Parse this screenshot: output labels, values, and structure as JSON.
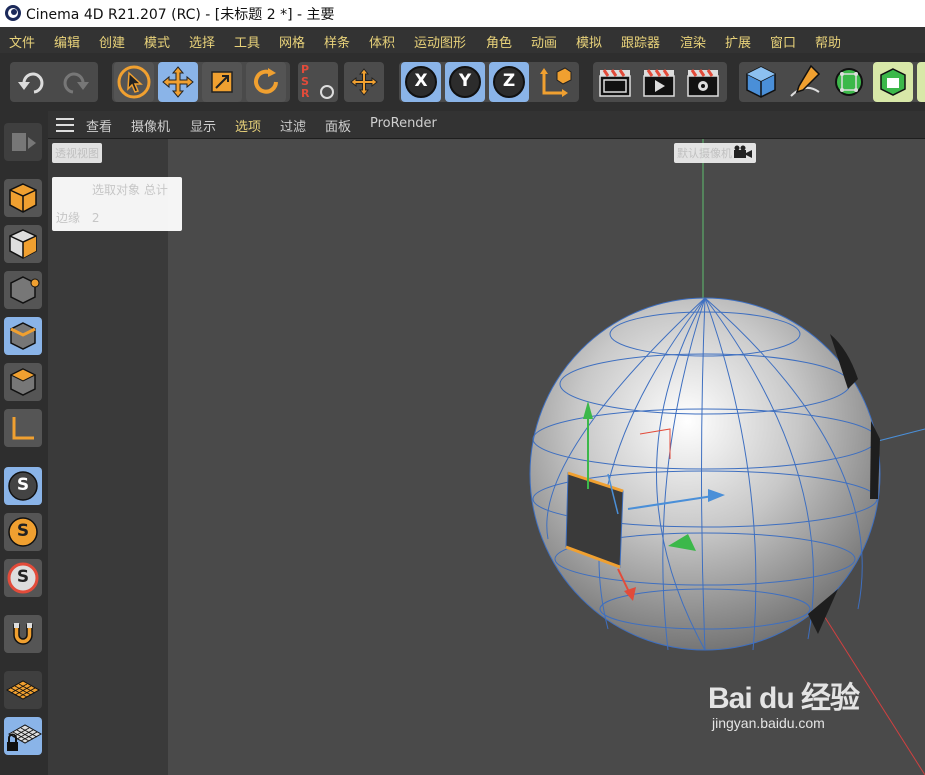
{
  "window": {
    "title": "Cinema 4D R21.207 (RC) - [未标题 2 *] - 主要"
  },
  "menu": [
    "文件",
    "编辑",
    "创建",
    "模式",
    "选择",
    "工具",
    "网格",
    "样条",
    "体积",
    "运动图形",
    "角色",
    "动画",
    "模拟",
    "跟踪器",
    "渲染",
    "扩展",
    "窗口",
    "帮助"
  ],
  "toolbar": {
    "psr_label": [
      "P",
      "S",
      "R"
    ],
    "axis_x": "X",
    "axis_y": "Y",
    "axis_z": "Z"
  },
  "viewport_menu": [
    "查看",
    "摄像机",
    "显示",
    "选项",
    "过滤",
    "面板",
    "ProRender"
  ],
  "viewport": {
    "view_name": "透视视图",
    "camera_name": "默认摄像机",
    "hud": {
      "selected_label": "选取对象 总计",
      "edges_label": "边缘",
      "edges_count": "2"
    }
  },
  "mode_icons": [
    "S",
    "S",
    "S"
  ],
  "watermark": {
    "logo": "Bai du 经验",
    "url": "jingyan.baidu.com"
  },
  "colors": {
    "accent": "#e8d27a",
    "active_tool": "#8ab4e8",
    "selection": "#f0a030"
  }
}
